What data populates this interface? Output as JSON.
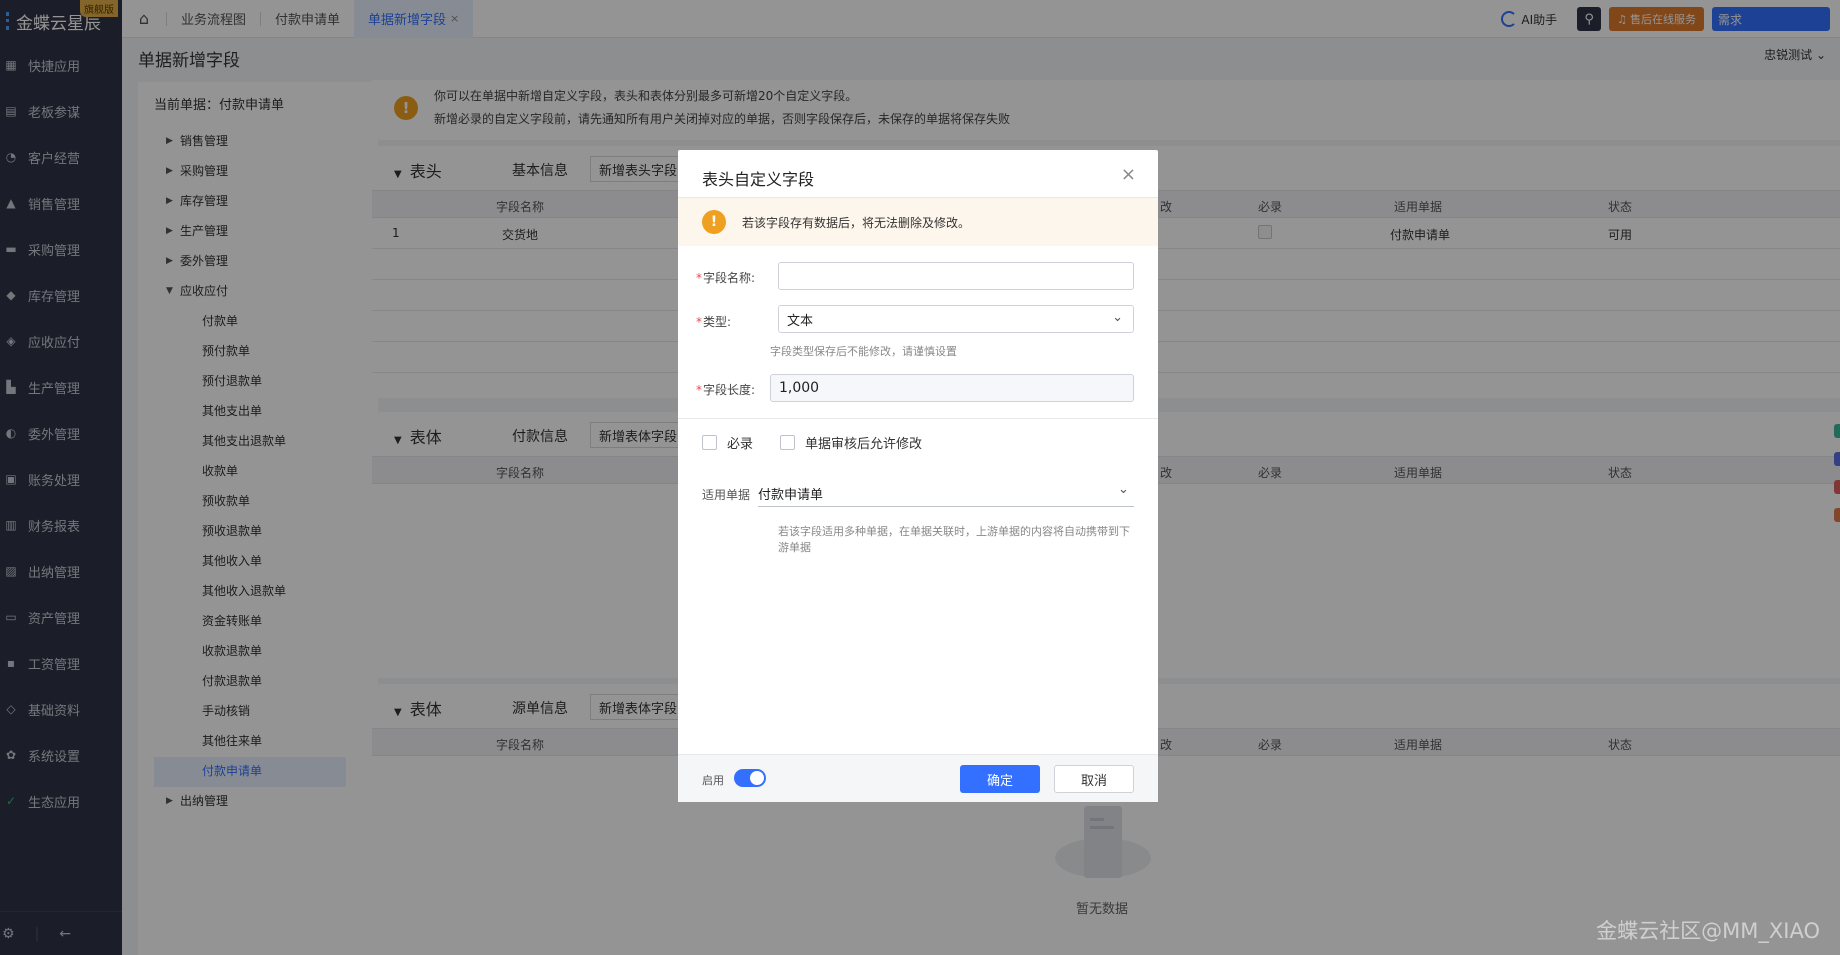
{
  "brand": {
    "name": "金蝶云星辰",
    "edition": "旗舰版"
  },
  "sidebar": {
    "items": [
      {
        "label": "快捷应用",
        "icon": "grid-icon"
      },
      {
        "label": "老板参谋",
        "icon": "chart-icon"
      },
      {
        "label": "客户经营",
        "icon": "user-icon"
      },
      {
        "label": "销售管理",
        "icon": "trend-icon"
      },
      {
        "label": "采购管理",
        "icon": "cart-icon"
      },
      {
        "label": "库存管理",
        "icon": "box-icon"
      },
      {
        "label": "应收应付",
        "icon": "coin-icon"
      },
      {
        "label": "生产管理",
        "icon": "factory-icon"
      },
      {
        "label": "委外管理",
        "icon": "handshake-icon"
      },
      {
        "label": "账务处理",
        "icon": "ledger-icon"
      },
      {
        "label": "财务报表",
        "icon": "report-icon"
      },
      {
        "label": "出纳管理",
        "icon": "cashier-icon"
      },
      {
        "label": "资产管理",
        "icon": "asset-icon"
      },
      {
        "label": "工资管理",
        "icon": "salary-icon"
      },
      {
        "label": "基础资料",
        "icon": "layers-icon"
      },
      {
        "label": "系统设置",
        "icon": "gear-icon"
      },
      {
        "label": "生态应用",
        "icon": "check-shield-icon"
      }
    ]
  },
  "topbar": {
    "tabs": [
      {
        "label": "业务流程图"
      },
      {
        "label": "付款申请单"
      },
      {
        "label": "单据新增字段",
        "close": "×"
      }
    ],
    "ai_label": "AI助手",
    "service_label": "售后在线服务",
    "need_label": "需求"
  },
  "page": {
    "title": "单据新增字段",
    "user": "忠锐测试"
  },
  "tree": {
    "current_doc": "当前单据：付款申请单",
    "groups_top": [
      "销售管理",
      "采购管理",
      "库存管理",
      "生产管理",
      "委外管理"
    ],
    "expanded_group": "应收应付",
    "children": [
      "付款单",
      "预付款单",
      "预付退款单",
      "其他支出单",
      "其他支出退款单",
      "收款单",
      "预收款单",
      "预收退款单",
      "其他收入单",
      "其他收入退款单",
      "资金转账单",
      "收款退款单",
      "付款退款单",
      "手动核销",
      "其他往来单",
      "付款申请单"
    ],
    "groups_bottom": [
      "出纳管理"
    ]
  },
  "notice": {
    "line1": "你可以在单据中新增自定义字段，表头和表体分别最多可新增20个自定义字段。",
    "line2": "新增必录的自定义字段前，请先通知所有用户关闭掉对应的单据，否则字段保存后，未保存的单据将保存失败"
  },
  "columns": {
    "name": "字段名称",
    "modify": "改",
    "required": "必录",
    "applies": "适用单据",
    "status": "状态"
  },
  "sections": [
    {
      "title": "表头",
      "sub": "基本信息",
      "add": "新增表头字段",
      "rows": [
        {
          "no": "1",
          "name": "交货地",
          "applies": "付款申请单",
          "status": "可用"
        }
      ]
    },
    {
      "title": "表体",
      "sub": "付款信息",
      "add": "新增表体字段"
    },
    {
      "title": "表体",
      "sub": "源单信息",
      "add": "新增表体字段"
    }
  ],
  "empty_text": "暂无数据",
  "watermark": "金蝶云社区@MM_XIAO",
  "modal": {
    "title": "表头自定义字段",
    "close": "×",
    "warning": "若该字段存有数据后，将无法删除及修改。",
    "field_name_label": "字段名称:",
    "field_name_value": "",
    "type_label": "类型:",
    "type_value": "文本",
    "type_hint": "字段类型保存后不能修改，请谨慎设置",
    "length_label": "字段长度:",
    "length_value": "1,000",
    "required_label": "必录",
    "allow_edit_label": "单据审核后允许修改",
    "applies_label": "适用单据",
    "applies_value": "付款申请单",
    "applies_hint": "若该字段适用多种单据，在单据关联时，上游单据的内容将自动携带到下游单据",
    "enable_label": "启用",
    "enabled": true,
    "ok": "确定",
    "cancel": "取消"
  },
  "colors": {
    "accent": "#3370ff",
    "sidebar": "#2f3545",
    "warning": "#f0a020"
  }
}
